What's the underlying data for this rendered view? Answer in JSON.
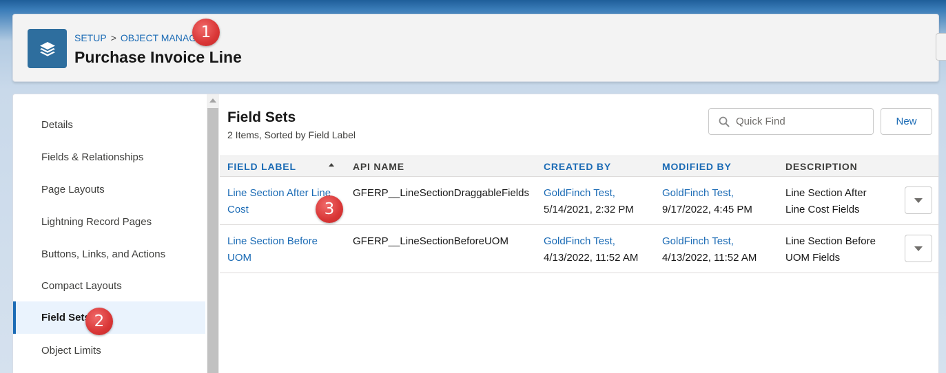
{
  "header": {
    "breadcrumb": {
      "setup": "SETUP",
      "separator": ">",
      "object_manager": "OBJECT MANAGER"
    },
    "title": "Purchase Invoice Line",
    "icon": "layers-icon"
  },
  "sidebar": {
    "items": [
      {
        "label": "Details"
      },
      {
        "label": "Fields & Relationships"
      },
      {
        "label": "Page Layouts"
      },
      {
        "label": "Lightning Record Pages"
      },
      {
        "label": "Buttons, Links, and Actions"
      },
      {
        "label": "Compact Layouts"
      },
      {
        "label": "Field Sets",
        "active": true
      },
      {
        "label": "Object Limits"
      }
    ]
  },
  "content": {
    "title": "Field Sets",
    "subtitle": "2 Items, Sorted by Field Label",
    "search_placeholder": "Quick Find",
    "new_label": "New",
    "columns": [
      "FIELD LABEL",
      "API NAME",
      "CREATED BY",
      "MODIFIED BY",
      "DESCRIPTION"
    ],
    "rows": [
      {
        "field_label_line1": "Line Section After Line",
        "field_label_line2": "Cost",
        "api_name": "GFERP__LineSectionDraggableFields",
        "created_by_name": "GoldFinch Test,",
        "created_by_date": "5/14/2021, 2:32 PM",
        "modified_by_name": "GoldFinch Test,",
        "modified_by_date": "9/17/2022, 4:45 PM",
        "description_line1": "Line Section After",
        "description_line2": "Line Cost Fields"
      },
      {
        "field_label_line1": "Line Section Before",
        "field_label_line2": "UOM",
        "api_name": "GFERP__LineSectionBeforeUOM",
        "created_by_name": "GoldFinch Test,",
        "created_by_date": "4/13/2022, 11:52 AM",
        "modified_by_name": "GoldFinch Test,",
        "modified_by_date": "4/13/2022, 11:52 AM",
        "description_line1": "Line Section Before",
        "description_line2": "UOM Fields"
      }
    ]
  },
  "annotations": {
    "badge_1": "1",
    "badge_2": "2",
    "badge_3": "3"
  },
  "colors": {
    "link": "#1b6bb5",
    "icon_bg": "#2e6e9e",
    "badge": "#d93636",
    "active_bg": "#eaf3fd"
  }
}
